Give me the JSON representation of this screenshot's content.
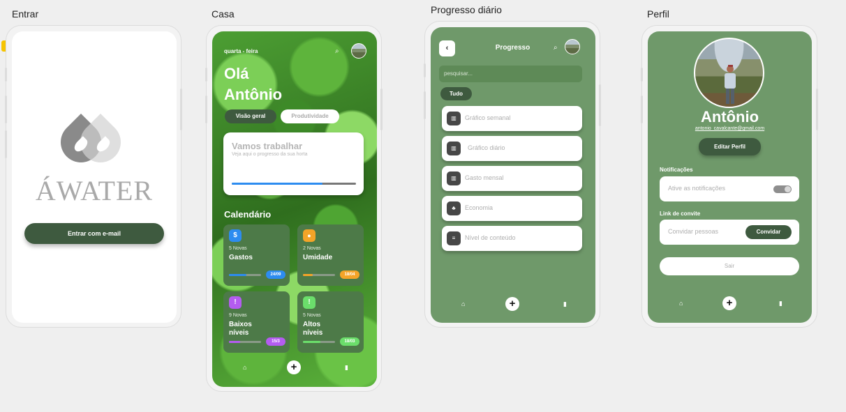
{
  "frames": {
    "entrar": "Entrar",
    "casa": "Casa",
    "progresso": "Progresso diário",
    "perfil": "Perfil"
  },
  "entrar": {
    "logo_text": "ÁWATER",
    "email_button": "Entrar com e-mail"
  },
  "casa": {
    "date": "quarta - feira",
    "greeting_line1": "Olá",
    "greeting_line2": "Antônio",
    "tabs": [
      "Visão geral",
      "Produtividade"
    ],
    "work_card": {
      "title": "Vamos trabalhar",
      "subtitle": "Veja aqui o progresso da sua horta",
      "progress": 0.73
    },
    "calendar_label": "Calendário",
    "tiles": [
      {
        "icon": "$",
        "icon_name": "dollar-icon",
        "color": "#2d8cf0",
        "count": "5 Novas",
        "name": "Gastos",
        "badge": "24/09",
        "progress": 0.55
      },
      {
        "icon": "💧",
        "icon_name": "drop-icon",
        "color": "#f4a428",
        "count": "2 Novas",
        "name": "Umidade",
        "badge": "18/04",
        "progress": 0.3
      },
      {
        "icon": "🌡",
        "icon_name": "thermometer-icon",
        "color": "#b45cf0",
        "count": "9 Novas",
        "name": "Baixos níveis",
        "badge": "15/3",
        "progress": 0.35
      },
      {
        "icon": "🌡",
        "icon_name": "thermometer-icon",
        "color": "#6bde6b",
        "count": "5 Novas",
        "name": "Altos níveis",
        "badge": "18/03",
        "progress": 0.55
      }
    ]
  },
  "progresso": {
    "title": "Progresso",
    "search_placeholder": "pesquisar...",
    "filter": "Tudo",
    "items": [
      {
        "label": "Gráfico semanal",
        "icon_name": "chart-icon"
      },
      {
        "label": "Gráfico diário",
        "icon_name": "chart-icon"
      },
      {
        "label": "Gasto mensal",
        "icon_name": "chart-icon"
      },
      {
        "label": "Economia",
        "icon_name": "savings-icon"
      },
      {
        "label": "Nível de conteúdo",
        "icon_name": "list-icon"
      }
    ]
  },
  "perfil": {
    "name": "Antônio",
    "email": "antonio_cavalcante@gmail.com",
    "edit_button": "Editar Perfil",
    "notifications_label": "Notificações",
    "notifications_text": "Ative as notificações",
    "invite_label": "Link de convite",
    "invite_text": "Convidar pessoas",
    "invite_button": "Convidar",
    "logout": "Sair"
  },
  "nav": {
    "plus": "+"
  }
}
